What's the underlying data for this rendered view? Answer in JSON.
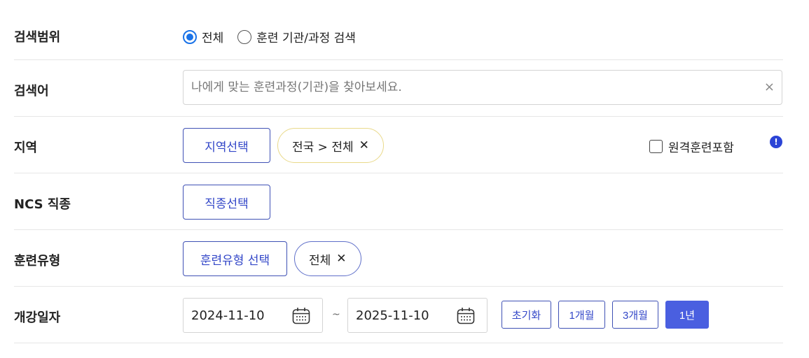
{
  "rows": {
    "scope": {
      "label": "검색범위",
      "options": [
        {
          "label": "전체",
          "checked": true
        },
        {
          "label": "훈련 기관/과정 검색",
          "checked": false
        }
      ]
    },
    "keyword": {
      "label": "검색어",
      "placeholder": "나에게 맞는 훈련과정(기관)을 찾아보세요.",
      "clear_symbol": "×"
    },
    "region": {
      "label": "지역",
      "select_button": "지역선택",
      "chip_label": "전국 > 전체",
      "chip_close": "✕",
      "checkbox_label": "원격훈련포함",
      "checkbox_checked": false,
      "info_symbol": "!"
    },
    "ncs": {
      "label": "NCS 직종",
      "select_button": "직종선택"
    },
    "training_type": {
      "label": "훈련유형",
      "select_button": "훈련유형 선택",
      "chip_label": "전체",
      "chip_close": "✕"
    },
    "start_date": {
      "label": "개강일자",
      "from": "2024-11-10",
      "separator": "~",
      "to": "2025-11-10",
      "period_buttons": [
        "초기화",
        "1개월",
        "3개월",
        "1년"
      ],
      "active_period": "1년"
    }
  },
  "colors": {
    "accent": "#3347c8",
    "active_button": "#4a5fe0",
    "radio_checked": "#1a73e8",
    "chip_yellow_border": "#e9d98a",
    "info_icon": "#2b44d6"
  }
}
